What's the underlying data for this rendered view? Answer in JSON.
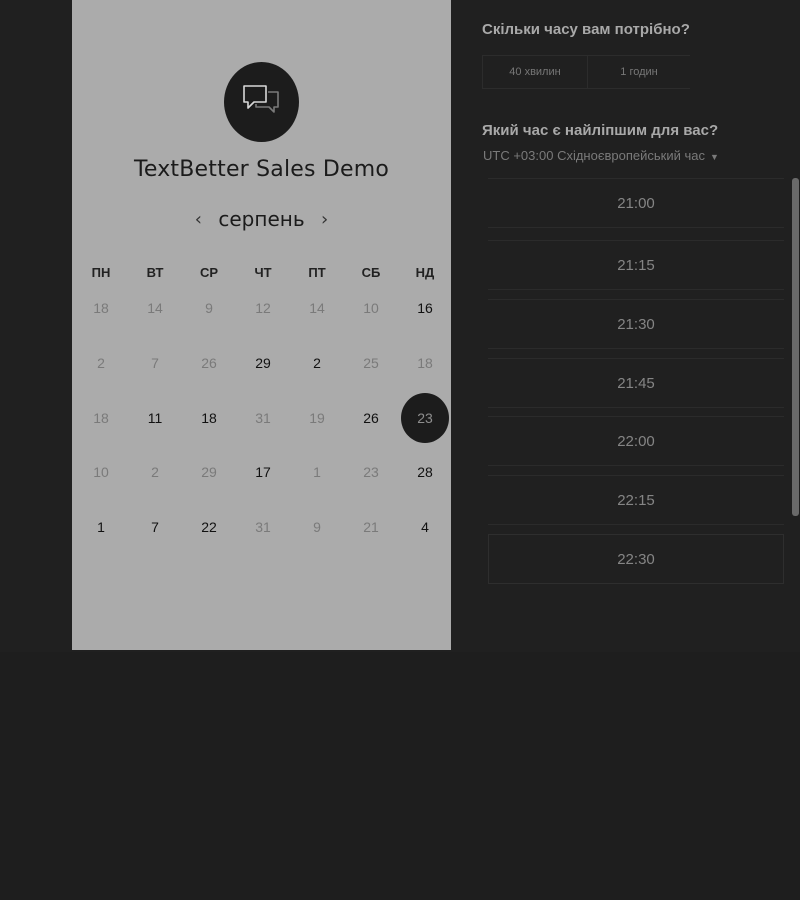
{
  "event": {
    "title": "TextBetter Sales Demo",
    "logo_icon": "chat-bubbles-icon"
  },
  "calendar": {
    "month": "серпень",
    "prev_icon": "chevron-left-icon",
    "next_icon": "chevron-right-icon",
    "prev_glyph": "‹",
    "next_glyph": "›",
    "weekdays": [
      "ПН",
      "ВТ",
      "СР",
      "ЧТ",
      "ПТ",
      "СБ",
      "НД"
    ],
    "weeks": [
      [
        {
          "d": "18",
          "a": false
        },
        {
          "d": "14",
          "a": false
        },
        {
          "d": "9",
          "a": false
        },
        {
          "d": "12",
          "a": false
        },
        {
          "d": "14",
          "a": false
        },
        {
          "d": "10",
          "a": false
        },
        {
          "d": "16",
          "a": true
        }
      ],
      [
        {
          "d": "2",
          "a": false
        },
        {
          "d": "7",
          "a": false
        },
        {
          "d": "26",
          "a": false
        },
        {
          "d": "29",
          "a": true
        },
        {
          "d": "2",
          "a": true
        },
        {
          "d": "25",
          "a": false
        },
        {
          "d": "18",
          "a": false
        }
      ],
      [
        {
          "d": "18",
          "a": false
        },
        {
          "d": "11",
          "a": true
        },
        {
          "d": "18",
          "a": true
        },
        {
          "d": "31",
          "a": false
        },
        {
          "d": "19",
          "a": false
        },
        {
          "d": "26",
          "a": true
        },
        {
          "d": "23",
          "a": true,
          "selected": true
        }
      ],
      [
        {
          "d": "10",
          "a": false
        },
        {
          "d": "2",
          "a": false
        },
        {
          "d": "29",
          "a": false
        },
        {
          "d": "17",
          "a": true
        },
        {
          "d": "1",
          "a": false
        },
        {
          "d": "23",
          "a": false
        },
        {
          "d": "28",
          "a": true
        }
      ],
      [
        {
          "d": "1",
          "a": true
        },
        {
          "d": "7",
          "a": true
        },
        {
          "d": "22",
          "a": true
        },
        {
          "d": "31",
          "a": false
        },
        {
          "d": "9",
          "a": false
        },
        {
          "d": "21",
          "a": false
        },
        {
          "d": "4",
          "a": true
        }
      ]
    ]
  },
  "booking": {
    "duration_question": "Скільки часу вам потрібно?",
    "durations": [
      "40 хвилин",
      "1 годин"
    ],
    "time_question": "Який час є найліпшим для вас?",
    "timezone": "UTC +03:00 Східноєвропейський час",
    "timezone_caret_icon": "caret-down-icon",
    "slots": [
      "21:00",
      "21:15",
      "21:30",
      "21:45",
      "22:00",
      "22:15",
      "22:30"
    ]
  },
  "colors": {
    "panel": "#ababab",
    "background": "#1e1e1e",
    "selected_day": "#1c1c1c"
  }
}
